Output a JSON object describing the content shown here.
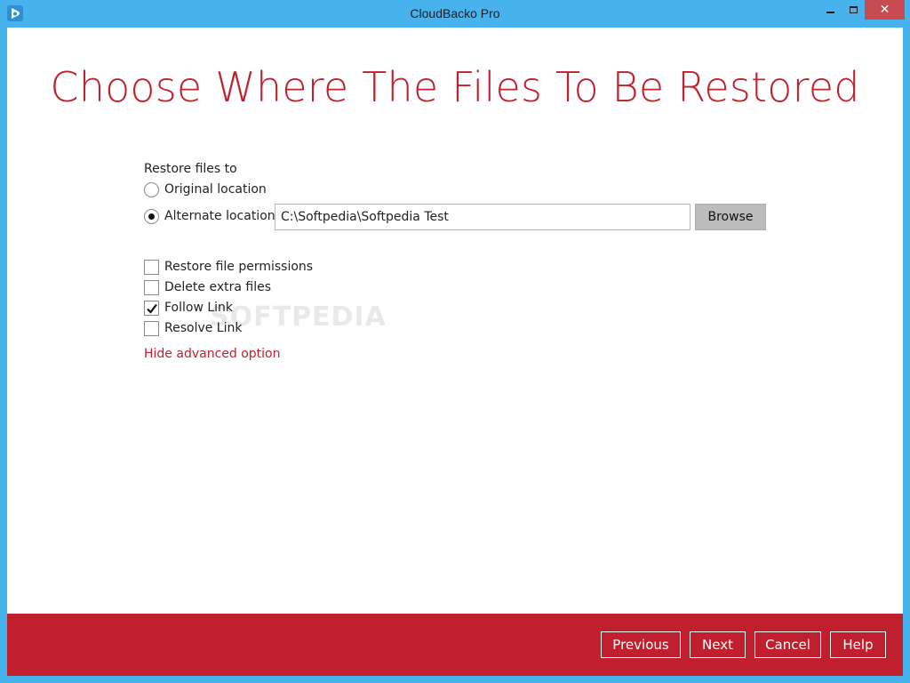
{
  "window": {
    "title": "CloudBacko Pro",
    "close_glyph": "✕"
  },
  "page": {
    "title": "Choose Where The Files To Be Restored"
  },
  "restore": {
    "heading": "Restore files to",
    "options": [
      {
        "label": "Original location",
        "selected": false
      },
      {
        "label": "Alternate location",
        "selected": true
      }
    ],
    "path_value": "C:\\Softpedia\\Softpedia Test",
    "browse_label": "Browse"
  },
  "advanced": {
    "checkboxes": [
      {
        "label": "Restore file permissions",
        "checked": false
      },
      {
        "label": "Delete extra files",
        "checked": false
      },
      {
        "label": "Follow Link",
        "checked": true
      },
      {
        "label": "Resolve Link",
        "checked": false
      }
    ],
    "toggle_label": "Hide advanced option"
  },
  "footer": {
    "previous_label": "Previous",
    "next_label": "Next",
    "cancel_label": "Cancel",
    "help_label": "Help"
  },
  "watermark": "SOFTPEDIA",
  "colors": {
    "accent": "#c0202d",
    "window_frame": "#47b2eb",
    "close_button": "#c74b50"
  },
  "icons": {
    "app": "cloudbacko-logo-icon",
    "check": "checkmark-icon"
  }
}
